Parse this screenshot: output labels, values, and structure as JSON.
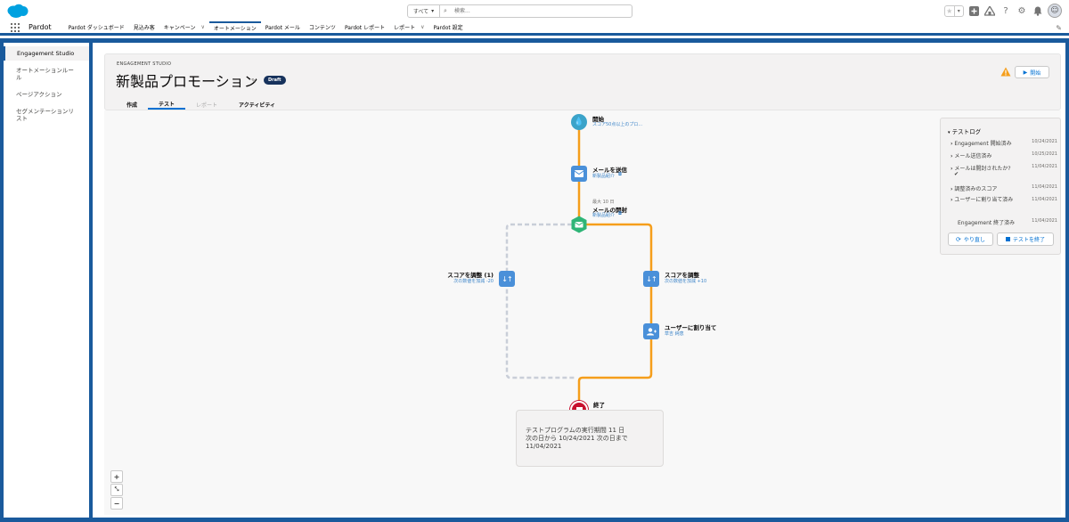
{
  "header": {
    "search_scope": "すべて",
    "search_placeholder": "検索..."
  },
  "nav": {
    "app_name": "Pardot",
    "items": [
      {
        "label": "Pardot ダッシュボード",
        "has_menu": false
      },
      {
        "label": "見込み客",
        "has_menu": false
      },
      {
        "label": "キャンペーン",
        "has_menu": true
      },
      {
        "label": "オートメーション",
        "has_menu": false,
        "active": true
      },
      {
        "label": "Pardot メール",
        "has_menu": false
      },
      {
        "label": "コンテンツ",
        "has_menu": false
      },
      {
        "label": "Pardot レポート",
        "has_menu": false
      },
      {
        "label": "レポート",
        "has_menu": true
      },
      {
        "label": "Pardot 設定",
        "has_menu": false
      }
    ]
  },
  "sidebar": {
    "items": [
      {
        "label": "Engagement Studio",
        "active": true
      },
      {
        "label": "オートメーションルール"
      },
      {
        "label": "ページアクション"
      },
      {
        "label": "セグメンテーションリスト"
      }
    ]
  },
  "page": {
    "eyebrow": "ENGAGEMENT STUDIO",
    "title": "新製品プロモーション",
    "badge": "Draft",
    "start_button": "開始",
    "tabs": [
      {
        "label": "作成",
        "state": "normal"
      },
      {
        "label": "テスト",
        "state": "active"
      },
      {
        "label": "レポート",
        "state": "disabled"
      },
      {
        "label": "アクティビティ",
        "state": "normal"
      }
    ]
  },
  "flow": {
    "start": {
      "title": "開始",
      "sub": "スコア50点以上のプロ..."
    },
    "send_email": {
      "title": "メールを送信",
      "sub": "新製品紹介"
    },
    "email_open": {
      "meta": "最大 10 日",
      "title": "メールの開封",
      "sub": "新製品紹介"
    },
    "score_left": {
      "title": "スコアを調整 (1)",
      "sub": "次の数値を加減 -20"
    },
    "score_right": {
      "title": "スコアを調整",
      "sub": "次の数値を加減 +10"
    },
    "assign": {
      "title": "ユーザーに割り当て",
      "sub": "草吉 純恵"
    },
    "end": {
      "title": "終了"
    }
  },
  "summary": {
    "line1": "テストプログラムの実行期間 11 日",
    "line2": "次の日から 10/24/2021 次の日まで",
    "line3": "11/04/2021"
  },
  "testlog": {
    "title": "テストログ",
    "rows": [
      {
        "label": "Engagement 開始済み",
        "date": "10/24/2021",
        "chevron": true
      },
      {
        "label": "メール送信済み",
        "date": "10/25/2021",
        "chevron": true
      },
      {
        "label": "メールは開封されたか?",
        "date": "11/04/2021",
        "chevron": true,
        "check": true
      },
      {
        "label": "調整済みのスコア",
        "date": "11/04/2021",
        "chevron": true
      },
      {
        "label": "ユーザーに割り当て済み",
        "date": "11/04/2021",
        "chevron": true
      },
      {
        "label": "Engagement 終了済み",
        "date": "11/04/2021",
        "chevron": false
      }
    ],
    "redo_button": "やり直し",
    "end_button": "テストを終了"
  },
  "colors": {
    "brand_blue": "#1a5a9c",
    "flow_orange": "#f59e1b",
    "node_blue": "#4a90d9",
    "node_green": "#2fb577",
    "node_teal": "#3ba3c9",
    "node_red": "#c8102e"
  }
}
